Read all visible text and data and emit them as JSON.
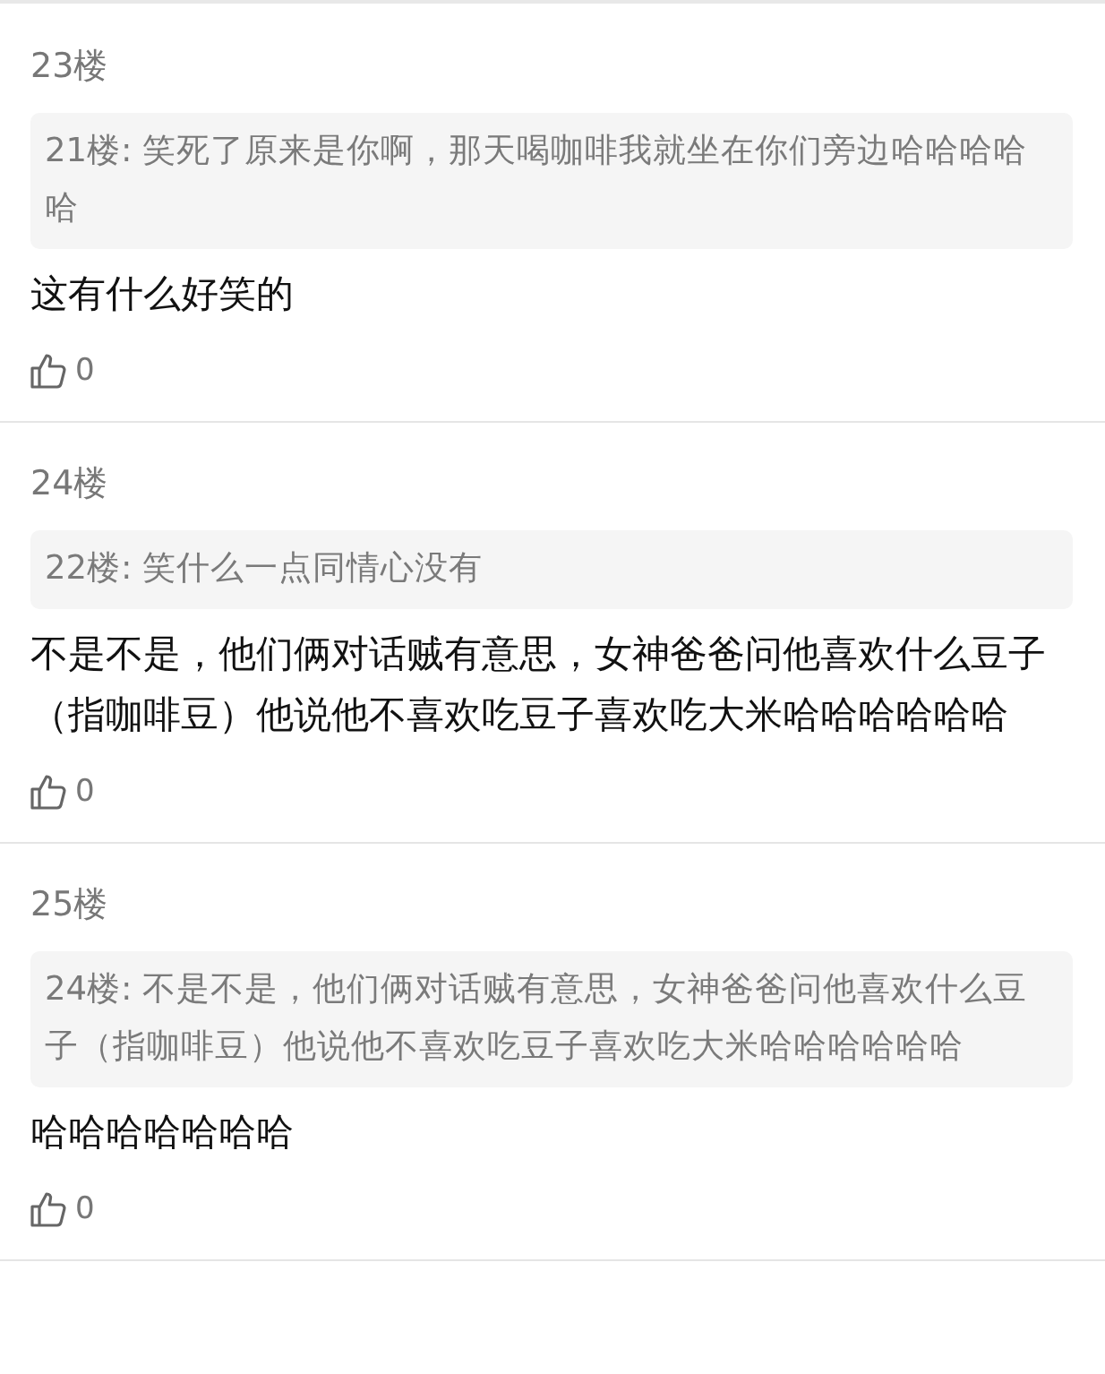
{
  "posts": [
    {
      "floor": "23楼",
      "quote": "21楼: 笑死了原来是你啊，那天喝咖啡我就坐在你们旁边哈哈哈哈哈",
      "body": "这有什么好笑的",
      "likes": "0"
    },
    {
      "floor": "24楼",
      "quote": "22楼: 笑什么一点同情心没有",
      "body": "不是不是，他们俩对话贼有意思，女神爸爸问他喜欢什么豆子（指咖啡豆）他说他不喜欢吃豆子喜欢吃大米哈哈哈哈哈哈",
      "likes": "0"
    },
    {
      "floor": "25楼",
      "quote": "24楼: 不是不是，他们俩对话贼有意思，女神爸爸问他喜欢什么豆子（指咖啡豆）他说他不喜欢吃豆子喜欢吃大米哈哈哈哈哈哈",
      "body": "哈哈哈哈哈哈哈",
      "likes": "0"
    }
  ]
}
